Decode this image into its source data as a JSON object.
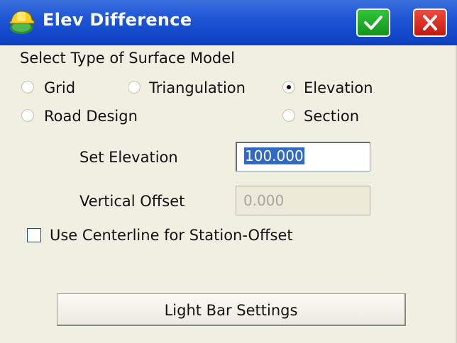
{
  "window": {
    "title": "Elev Difference",
    "ok_icon": "checkmark-icon",
    "close_icon": "close-x-icon",
    "app_icon": "hardhat-globe-icon"
  },
  "surface_model": {
    "heading": "Select Type of Surface Model",
    "options": [
      {
        "label": "Grid",
        "selected": false
      },
      {
        "label": "Triangulation",
        "selected": false
      },
      {
        "label": "Elevation",
        "selected": true
      },
      {
        "label": "Road Design",
        "selected": false
      },
      {
        "label": "Section",
        "selected": false
      }
    ]
  },
  "set_elevation": {
    "label": "Set Elevation",
    "value": "100.000"
  },
  "vertical_offset": {
    "label": "Vertical Offset",
    "value": "0.000"
  },
  "use_centerline": {
    "label": "Use Centerline for Station-Offset",
    "checked": false
  },
  "light_bar_button": {
    "label": "Light Bar Settings"
  }
}
